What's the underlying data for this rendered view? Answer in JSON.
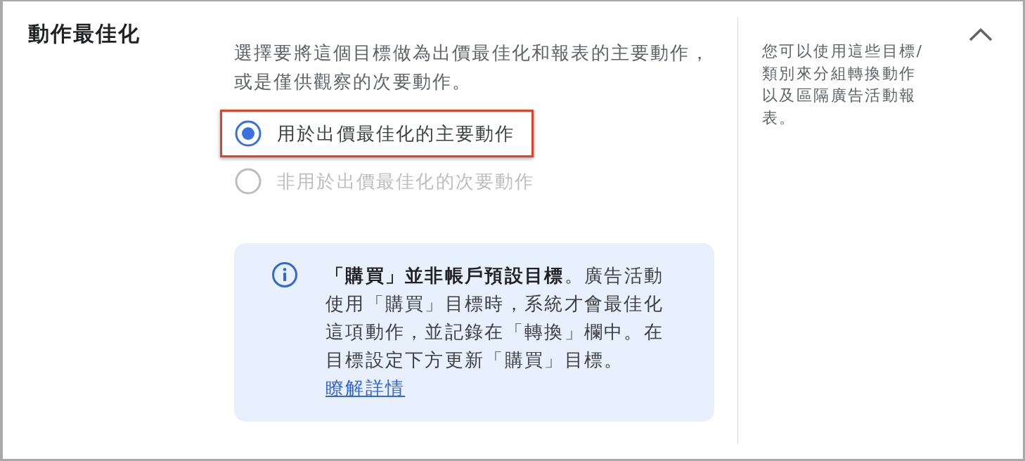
{
  "title": "動作最佳化",
  "expanded": true,
  "description": "選擇要將這個目標做為出價最佳化和報表的主要動作，或是僅供觀察的次要動作。",
  "options": [
    {
      "label": "用於出價最佳化的主要動作",
      "selected": true,
      "disabled": false,
      "highlighted": true
    },
    {
      "label": "非用於出價最佳化的次要動作",
      "selected": false,
      "disabled": true,
      "highlighted": false
    }
  ],
  "notice": {
    "text": "**「購買」並非帳戶預設目標**。廣告活動使用「購買」目標時，系統才會最佳化這項動作，並記錄在「轉換」欄中。在目標設定下方更新「購買」目標。",
    "link": "瞭解詳情"
  },
  "help_text": "您可以使用這些目標/類別來分組轉換動作以及區隔廣告活動報表。"
}
